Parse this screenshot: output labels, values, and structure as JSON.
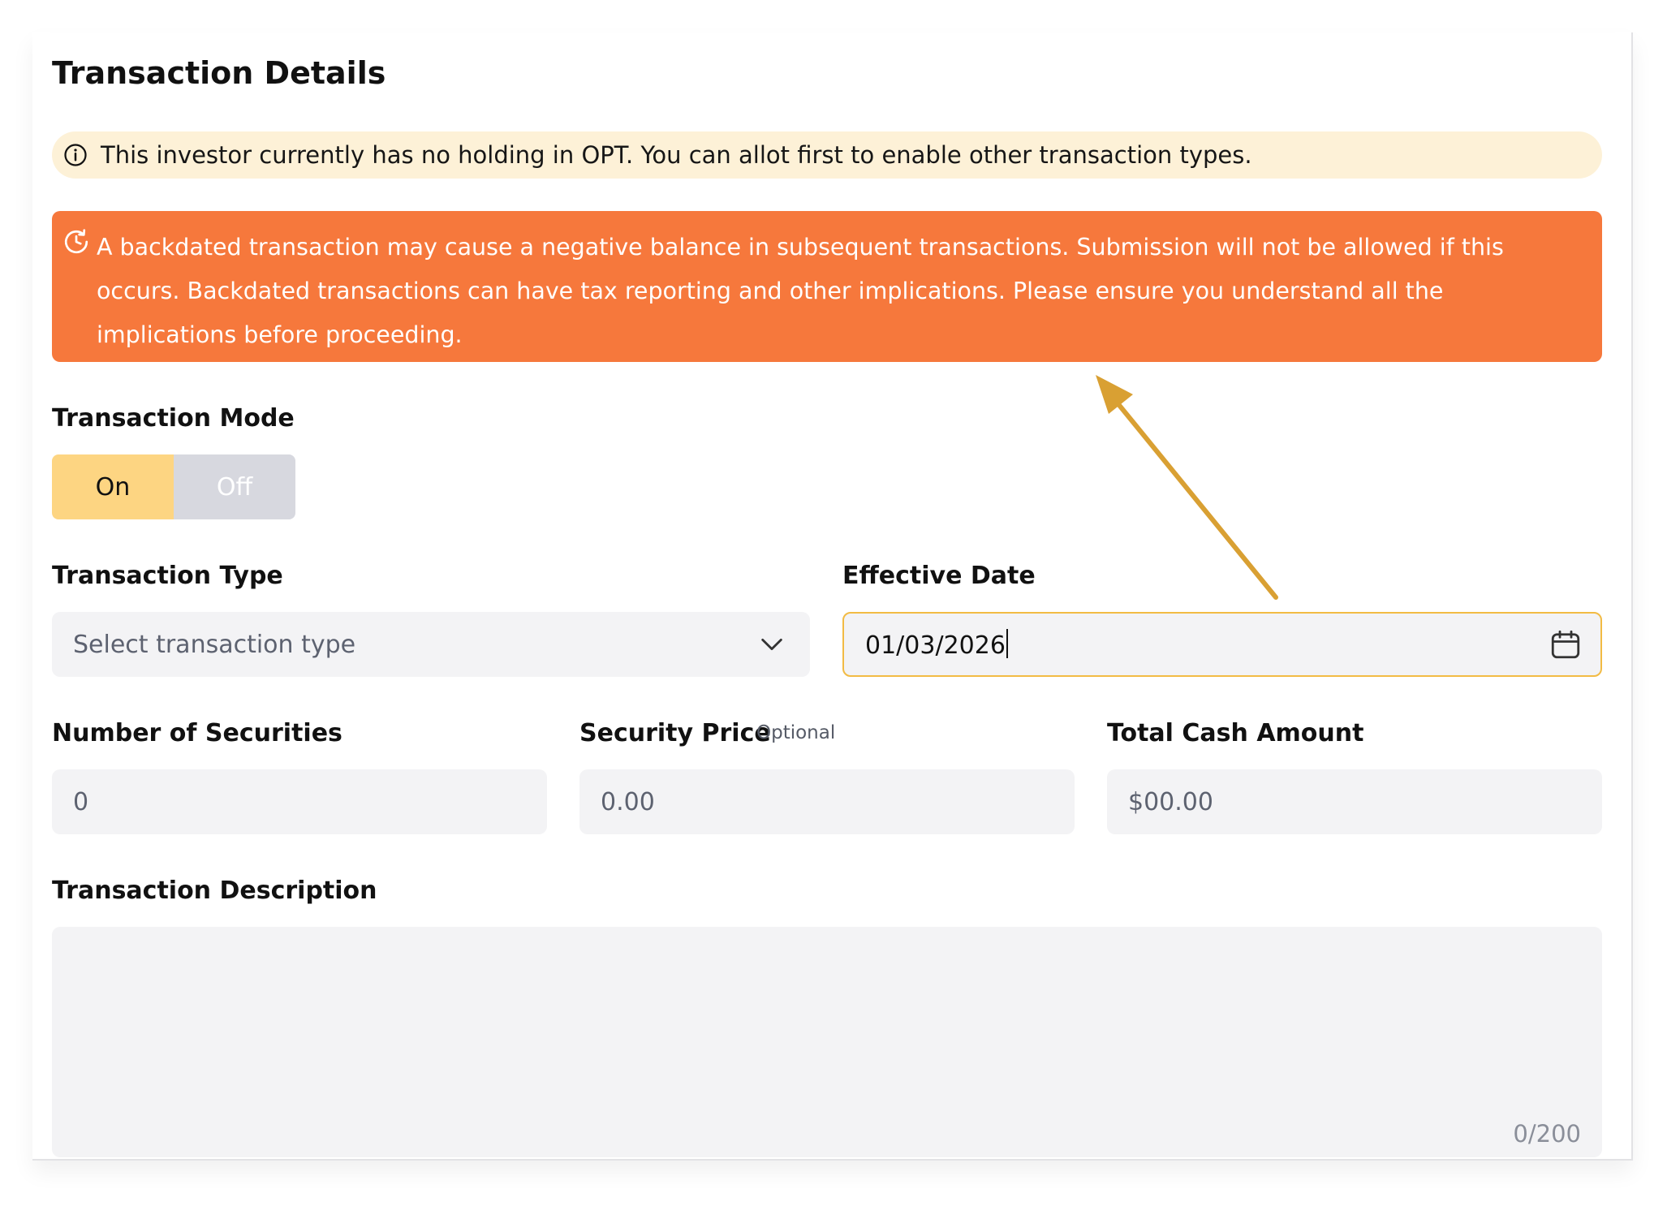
{
  "page": {
    "title": "Transaction Details"
  },
  "info_banner": {
    "icon": "info-icon",
    "text": "This investor currently has no holding in OPT. You can allot first to enable other transaction types."
  },
  "warning_banner": {
    "icon": "clock-history-icon",
    "text": "A backdated transaction may cause a negative balance in subsequent transactions. Submission will not be allowed if this occurs. Backdated transactions can have tax reporting and other implications. Please ensure you understand all the implications before proceeding.",
    "color": "#f6783c"
  },
  "transaction_mode": {
    "label": "Transaction Mode",
    "options": [
      "On",
      "Off"
    ],
    "selected": "On"
  },
  "transaction_type": {
    "label": "Transaction Type",
    "placeholder": "Select transaction type",
    "icon": "chevron-down-icon"
  },
  "effective_date": {
    "label": "Effective Date",
    "value": "01/03/2026",
    "icon": "calendar-icon"
  },
  "number_of_securities": {
    "label": "Number of Securities",
    "placeholder": "0"
  },
  "security_price": {
    "label": "Security Price",
    "optional_tag": "Optional",
    "placeholder": "0.00"
  },
  "total_cash_amount": {
    "label": "Total Cash Amount",
    "placeholder": "$00.00"
  },
  "transaction_description": {
    "label": "Transaction Description",
    "counter": "0/200"
  },
  "annotation": {
    "type": "arrow",
    "color": "#d9a033"
  },
  "colors": {
    "accent": "#f2bb44",
    "toggle_on": "#fdd582",
    "info_bg": "#fdf1d7"
  }
}
